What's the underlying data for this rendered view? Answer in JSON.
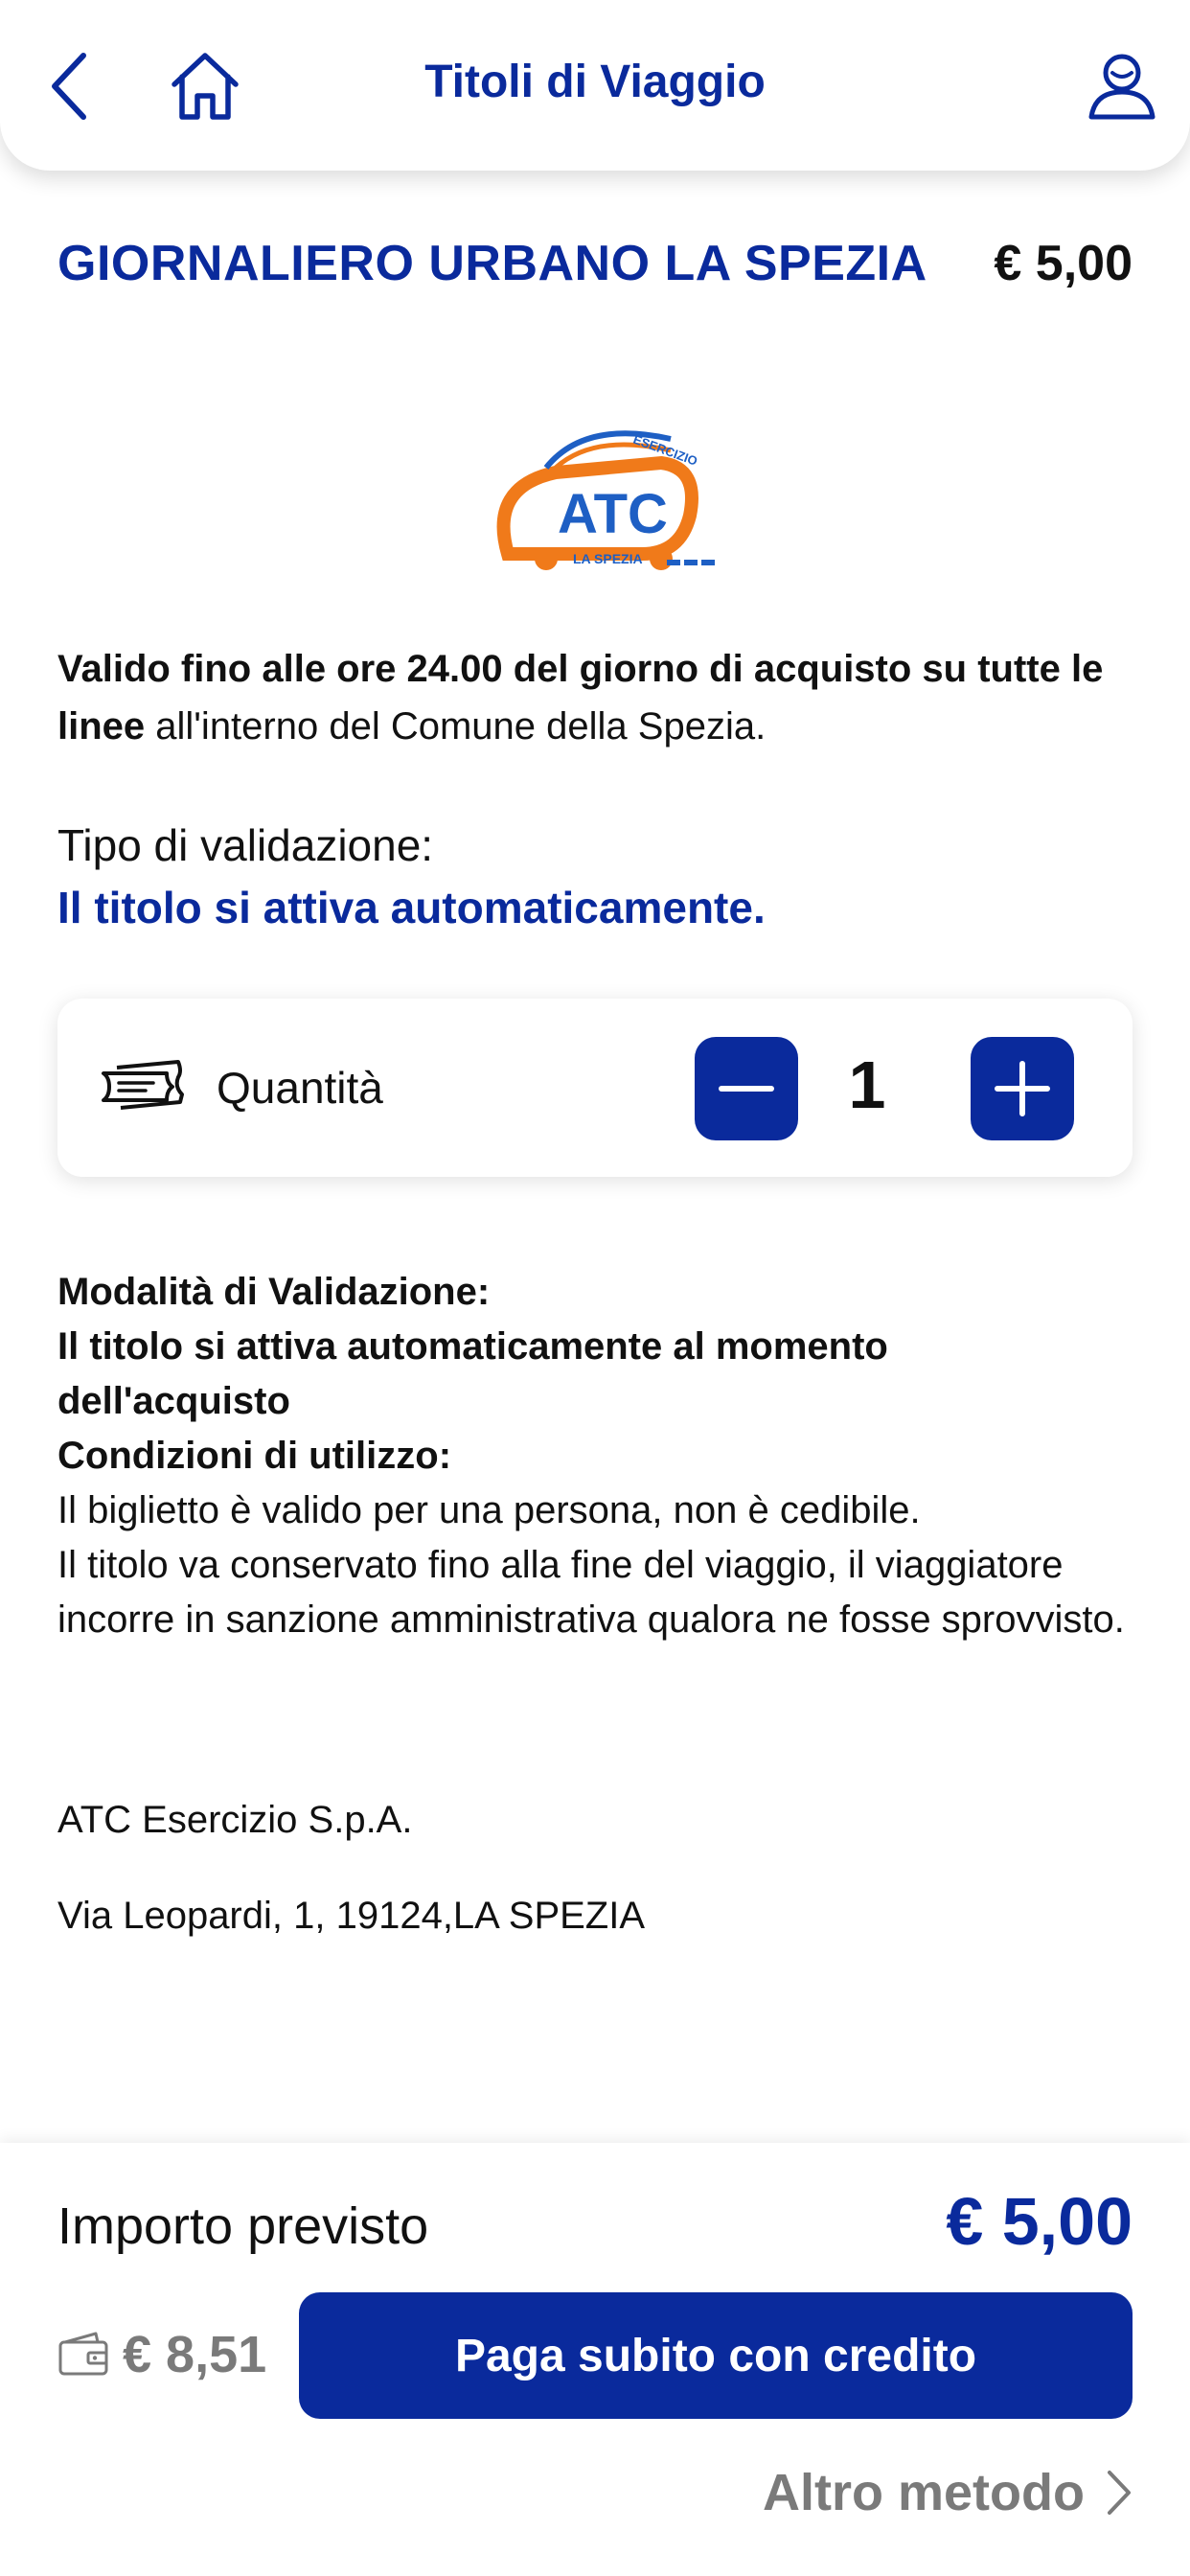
{
  "header": {
    "title": "Titoli di Viaggio",
    "back_icon": "chevron-left-icon",
    "home_icon": "home-icon",
    "user_icon": "user-icon"
  },
  "product": {
    "title": "GIORNALIERO URBANO LA SPEZIA",
    "price": "€ 5,00",
    "logo": {
      "top_text": "ESERCIZIO",
      "main_text": "ATC",
      "bottom_text": "LA SPEZIA"
    },
    "description_bold": "Valido fino alle ore 24.00 del giorno di acquisto su tutte le linee",
    "description_rest": " all'interno del Comune della Spezia."
  },
  "validation": {
    "label": "Tipo di validazione:",
    "value": "Il titolo si attiva automaticamente."
  },
  "quantity": {
    "label": "Quantità",
    "value": "1",
    "icon": "ticket-icon",
    "minus_icon": "minus-icon",
    "plus_icon": "plus-icon"
  },
  "rules": {
    "line1": "Modalità di Validazione:",
    "line2": "Il titolo si attiva automaticamente al momento dell'acquisto",
    "line3": "Condizioni di utilizzo:",
    "line4": "Il biglietto è valido per una persona, non è cedibile.",
    "line5": "Il titolo va conservato fino alla fine del viaggio, il viaggiatore incorre in sanzione amministrativa qualora ne fosse sprovvisto."
  },
  "company": {
    "name": "ATC Esercizio S.p.A.",
    "address": "Via Leopardi, 1, 19124,LA SPEZIA"
  },
  "footer": {
    "amount_label": "Importo previsto",
    "amount_value": "€ 5,00",
    "wallet_icon": "wallet-icon",
    "wallet_balance": "€ 8,51",
    "pay_button": "Paga subito con credito",
    "alt_method": "Altro metodo",
    "alt_icon": "chevron-right-icon"
  },
  "colors": {
    "primary": "#0a2a9c",
    "logo_orange": "#f07a1a",
    "logo_blue": "#1e5fc4",
    "muted_text": "#7a7a7a"
  }
}
